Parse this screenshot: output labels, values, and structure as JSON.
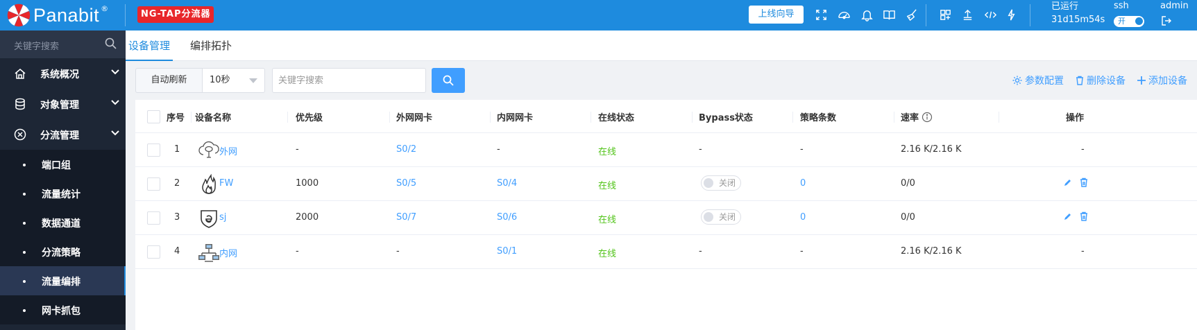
{
  "header": {
    "brand": "Panabit",
    "brand_mark": "®",
    "product_badge": "NG-TAP分流器",
    "guide_button": "上线向导",
    "uptime_label": "已运行",
    "uptime_value": "31d15m54s",
    "ssh_label": "ssh",
    "ssh_toggle": "开",
    "user": "admin",
    "icons": [
      "fullscreen-icon",
      "dashboard-icon",
      "bell-icon",
      "book-icon",
      "broom-icon",
      "layout-icon",
      "upload-icon",
      "code-icon",
      "bolt-icon",
      "logout-icon"
    ]
  },
  "sidebar": {
    "search_placeholder": "关键字搜索",
    "menus": [
      {
        "label": "系统概况",
        "icon": "home-icon"
      },
      {
        "label": "对象管理",
        "icon": "database-icon"
      },
      {
        "label": "分流管理",
        "icon": "shuffle-icon"
      }
    ],
    "sub_items": [
      "端口组",
      "流量统计",
      "数据通道",
      "分流策略",
      "流量编排",
      "网卡抓包"
    ],
    "active_sub": "流量编排"
  },
  "tabs": [
    "设备管理",
    "编排拓扑"
  ],
  "toolbar": {
    "auto_refresh_label": "自动刷新",
    "interval_value": "10秒",
    "search_placeholder": "关键字搜索",
    "actions": [
      "参数配置",
      "删除设备",
      "添加设备"
    ]
  },
  "table": {
    "headers": [
      "序号",
      "设备名称",
      "优先级",
      "外网网卡",
      "内网网卡",
      "在线状态",
      "Bypass状态",
      "策略条数",
      "速率",
      "操作"
    ],
    "rows": [
      {
        "index": "1",
        "name": "外网",
        "icon": "cloud-network-icon",
        "priority": "-",
        "wan": "S0/2",
        "lan": "-",
        "status": "在线",
        "bypass": "-",
        "policies": "-",
        "rate": "2.16 K/2.16 K",
        "ops": "-"
      },
      {
        "index": "2",
        "name": "FW",
        "icon": "firewall-flame-icon",
        "priority": "1000",
        "wan": "S0/5",
        "lan": "S0/4",
        "status": "在线",
        "bypass": "关闭",
        "policies": "0",
        "rate": "0/0",
        "ops": "edit"
      },
      {
        "index": "3",
        "name": "sj",
        "icon": "shield-e-icon",
        "priority": "2000",
        "wan": "S0/7",
        "lan": "S0/6",
        "status": "在线",
        "bypass": "关闭",
        "policies": "0",
        "rate": "0/0",
        "ops": "edit"
      },
      {
        "index": "4",
        "name": "内网",
        "icon": "lan-computers-icon",
        "priority": "-",
        "wan": "-",
        "lan": "S0/1",
        "status": "在线",
        "bypass": "-",
        "policies": "-",
        "rate": "2.16 K/2.16 K",
        "ops": "-"
      }
    ]
  }
}
